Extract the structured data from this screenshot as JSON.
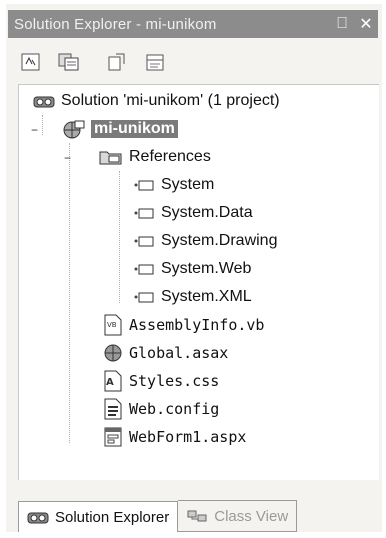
{
  "window": {
    "title": "Solution Explorer - mi-unikom",
    "pin_glyph": "⎕",
    "close_glyph": "✕"
  },
  "toolbar": {
    "buttons": [
      {
        "icon": "refresh-icon"
      },
      {
        "icon": "show-all-files-icon"
      },
      {
        "icon": "view-code-icon"
      },
      {
        "icon": "properties-icon"
      }
    ]
  },
  "tree": {
    "solution": "Solution 'mi-unikom' (1 project)",
    "project": "mi-unikom",
    "references_label": "References",
    "references": [
      "System",
      "System.Data",
      "System.Drawing",
      "System.Web",
      "System.XML"
    ],
    "files": [
      "AssemblyInfo.vb",
      "Global.asax",
      "Styles.css",
      "Web.config",
      "WebForm1.aspx"
    ],
    "collapse_glyph": "−"
  },
  "tabs": {
    "solution_explorer": "Solution Explorer",
    "class_view": "Class View"
  }
}
